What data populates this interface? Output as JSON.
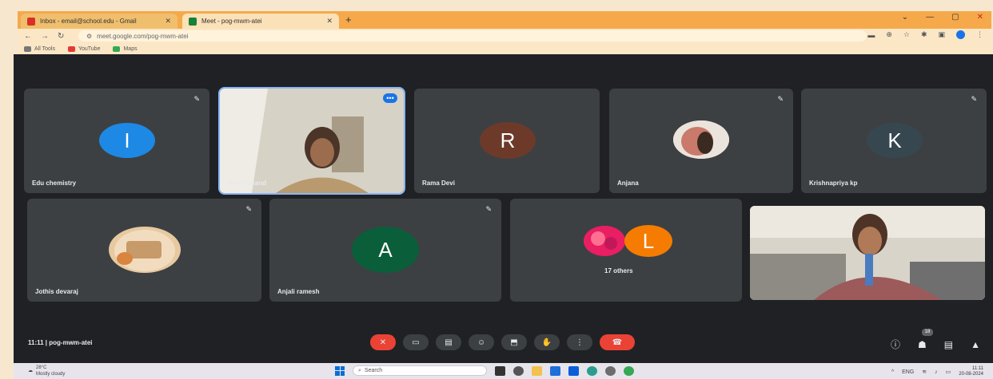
{
  "browser": {
    "tabs": [
      {
        "label": "Inbox - email@school.edu - Gmail",
        "favicon_color": "#d93025"
      },
      {
        "label": "Meet - pog-mwm-atei",
        "favicon_color": "#188038"
      }
    ],
    "new_tab": "+",
    "address": "meet.google.com/pog-mwm-atei",
    "bookmarks": [
      {
        "label": "All Tools",
        "color": "#777777"
      },
      {
        "label": "YouTube",
        "color": "#e53935"
      },
      {
        "label": "Maps",
        "color": "#34a853"
      }
    ]
  },
  "meet": {
    "tiles_row1": [
      {
        "name": "Edu chemistry",
        "avatar_letter": "I",
        "avatar_color": "#1e88e5"
      },
      {
        "name": "Rahul anand",
        "type": "video"
      },
      {
        "name": "Rama Devi",
        "avatar_letter": "R",
        "avatar_color": "#6d3a2a"
      },
      {
        "name": "Anjana",
        "type": "photo"
      },
      {
        "name": "Krishnapriya kp",
        "avatar_letter": "K",
        "avatar_color": "#37474f"
      }
    ],
    "tiles_row2": [
      {
        "name": "Jothis devaraj",
        "type": "photo"
      },
      {
        "name": "Anjali ramesh",
        "avatar_letter": "A",
        "avatar_color": "#0b5e3a"
      },
      {
        "name": "17 others",
        "avatar_letter": "L",
        "avatar_color": "#f57c00"
      },
      {
        "name": "",
        "type": "video"
      }
    ],
    "meeting_label": "11:11 | pog-mwm-atei",
    "participant_count": "18",
    "more_symbol": "•••"
  },
  "taskbar": {
    "weather_temp": "28°C",
    "weather_desc": "Mostly cloudy",
    "search_placeholder": "Search",
    "tray_lang": "ENG",
    "time": "11:11",
    "date": "20-08-2024"
  }
}
